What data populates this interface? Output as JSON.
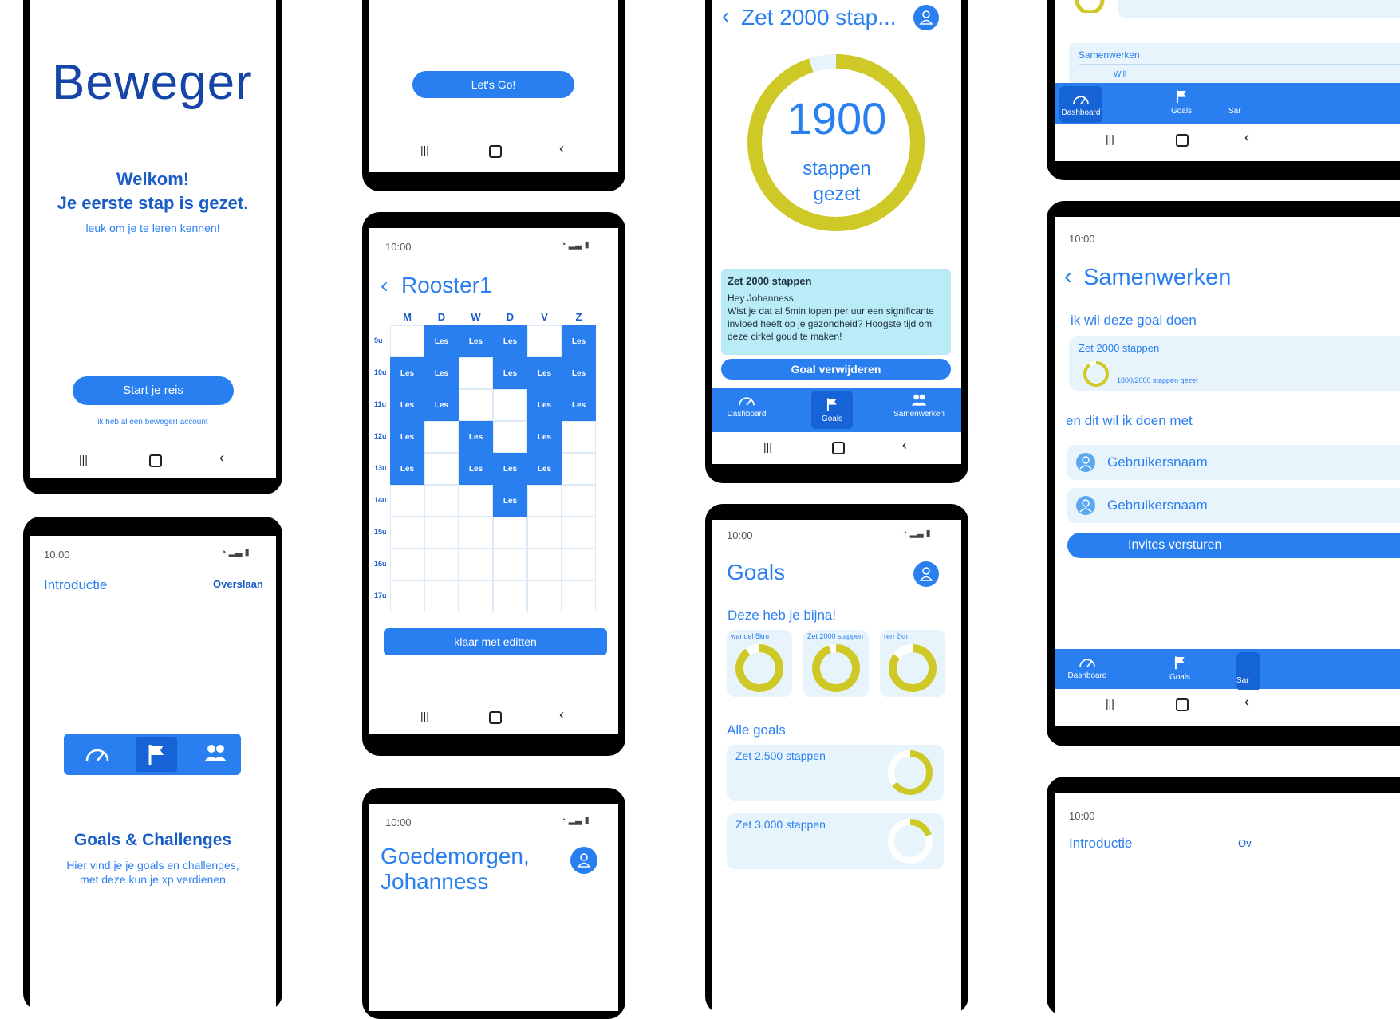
{
  "welcome": {
    "logo": "Beweger",
    "heading1": "Welkom!",
    "heading2": "Je eerste stap is gezet.",
    "sub": "leuk om je te leren kennen!",
    "start_button": "Start je reis",
    "account_link": "ik heb al een beweger! account"
  },
  "intro": {
    "time": "10:00",
    "title": "Introductie",
    "skip": "Overslaan",
    "feature_title": "Goals & Challenges",
    "feature_text_1": "Hier vind je je goals en challenges,",
    "feature_text_2": "met deze kun je xp verdienen"
  },
  "letsgo": {
    "button": "Let's Go!"
  },
  "rooster": {
    "time": "10:00",
    "title": "Rooster1",
    "days": [
      "M",
      "D",
      "W",
      "D",
      "V",
      "Z"
    ],
    "hours": [
      "9u",
      "10u",
      "11u",
      "12u",
      "13u",
      "14u",
      "15u",
      "16u",
      "17u"
    ],
    "cell_label": "Les",
    "grid": [
      [
        0,
        1,
        1,
        1,
        0,
        1
      ],
      [
        1,
        1,
        0,
        1,
        1,
        1
      ],
      [
        1,
        1,
        0,
        0,
        1,
        1
      ],
      [
        1,
        0,
        1,
        0,
        1,
        0
      ],
      [
        1,
        0,
        1,
        1,
        1,
        0
      ],
      [
        0,
        0,
        0,
        1,
        0,
        0
      ],
      [
        0,
        0,
        0,
        0,
        0,
        0
      ],
      [
        0,
        0,
        0,
        0,
        0,
        0
      ],
      [
        0,
        0,
        0,
        0,
        0,
        0
      ]
    ],
    "done_button": "klaar met editten"
  },
  "goedemorgen": {
    "time": "10:00",
    "greeting_1": "Goedemorgen,",
    "greeting_2": "Johanness"
  },
  "goal_detail": {
    "title": "Zet 2000 stap...",
    "count": "1900",
    "unit_1": "stappen",
    "unit_2": "gezet",
    "progress": 0.95,
    "card_title": "Zet 2000 stappen",
    "card_line1": "Hey Johanness,",
    "card_line2": "Wist je dat al 5min lopen per uur een significante",
    "card_line3": "invloed heeft op je gezondheid? Hoogste tijd om",
    "card_line4": "deze cirkel goud te maken!",
    "delete_button": "Goal verwijderen"
  },
  "tabs": {
    "dashboard": "Dashboard",
    "goals": "Goals",
    "samenwerken": "Samenwerken",
    "sam_short": "Sar"
  },
  "goals": {
    "time": "10:00",
    "title": "Goals",
    "almost_title": "Deze heb je bijna!",
    "almost": [
      {
        "label": "wandel 5km",
        "progress": 0.9
      },
      {
        "label": "Zet 2000 stappen",
        "progress": 0.95
      },
      {
        "label": "ren 2km",
        "progress": 0.85
      }
    ],
    "all_title": "Alle goals",
    "all": [
      {
        "label": "Zet 2.500 stappen",
        "progress": 0.65
      },
      {
        "label": "Zet 3.000 stappen",
        "progress": 0.2
      }
    ]
  },
  "samen_top": {
    "section": "Samenwerken",
    "user_partial": "Will"
  },
  "samenwerken": {
    "time": "10:00",
    "title": "Samenwerken",
    "goal_prompt": "ik wil deze goal doen",
    "goal_name": "Zet 2000 stappen",
    "goal_progress_text": "1800/2000 stappen gezet",
    "goal_progress": 0.9,
    "with_prompt": "en dit wil ik doen met",
    "users": [
      "Gebruikersnaam",
      "Gebruikersnaam"
    ],
    "invite_button": "Invites versturen"
  },
  "intro2": {
    "time": "10:00",
    "title": "Introductie",
    "skip_partial": "Ov"
  },
  "colors": {
    "accent": "#2a7ff0",
    "dark_blue": "#1545a6",
    "ring": "#cfc928",
    "ring_bg": "#e8f4fb",
    "card": "#b9ecf7"
  }
}
